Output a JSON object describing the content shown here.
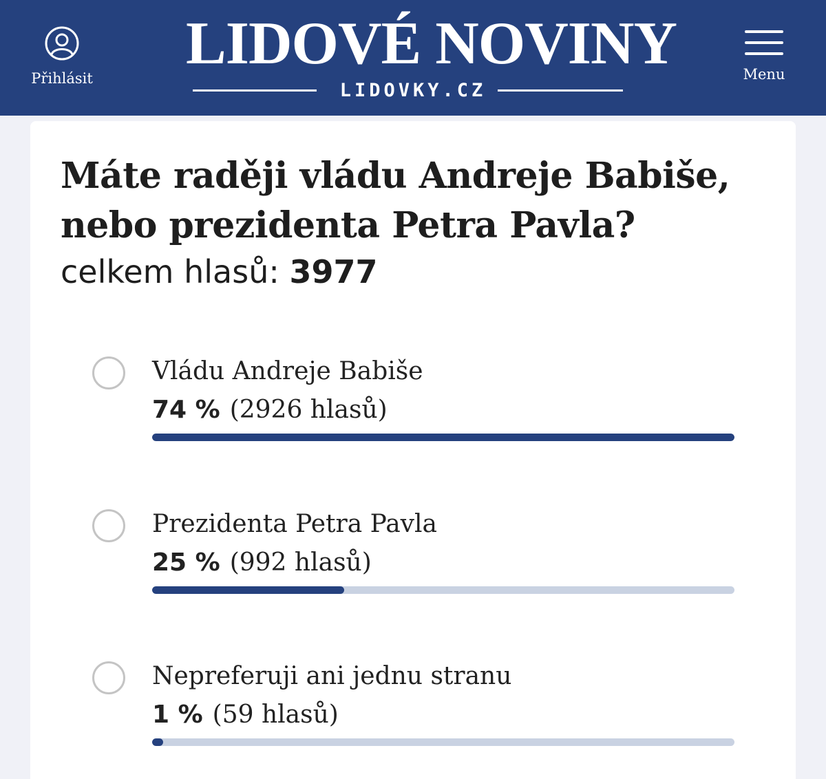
{
  "header": {
    "login_label": "Přihlásit",
    "logo_title": "LIDOVÉ NOVINY",
    "logo_site": "LIDOVKY.CZ",
    "menu_label": "Menu",
    "background_color": "#25417e"
  },
  "poll": {
    "question_line1": "Máte raději vládu Andreje Babiše,",
    "question_line2": "nebo prezidenta Petra Pavla?",
    "total_label": "celkem hlasů:",
    "total_votes": "3977",
    "options": [
      {
        "label": "Vládu Andreje Babiše",
        "percent_text": "74 %",
        "votes_text": "(2926 hlasů)",
        "fraction": 0.74
      },
      {
        "label": "Prezidenta Petra Pavla",
        "percent_text": "25 %",
        "votes_text": "(992 hlasů)",
        "fraction": 0.25
      },
      {
        "label": "Nepreferuji ani jednu stranu",
        "percent_text": "1 %",
        "votes_text": "(59 hlasů)",
        "fraction": 0.01
      }
    ],
    "bar_fill_color": "#25417e",
    "bar_track_color": "#c9d2e2"
  }
}
